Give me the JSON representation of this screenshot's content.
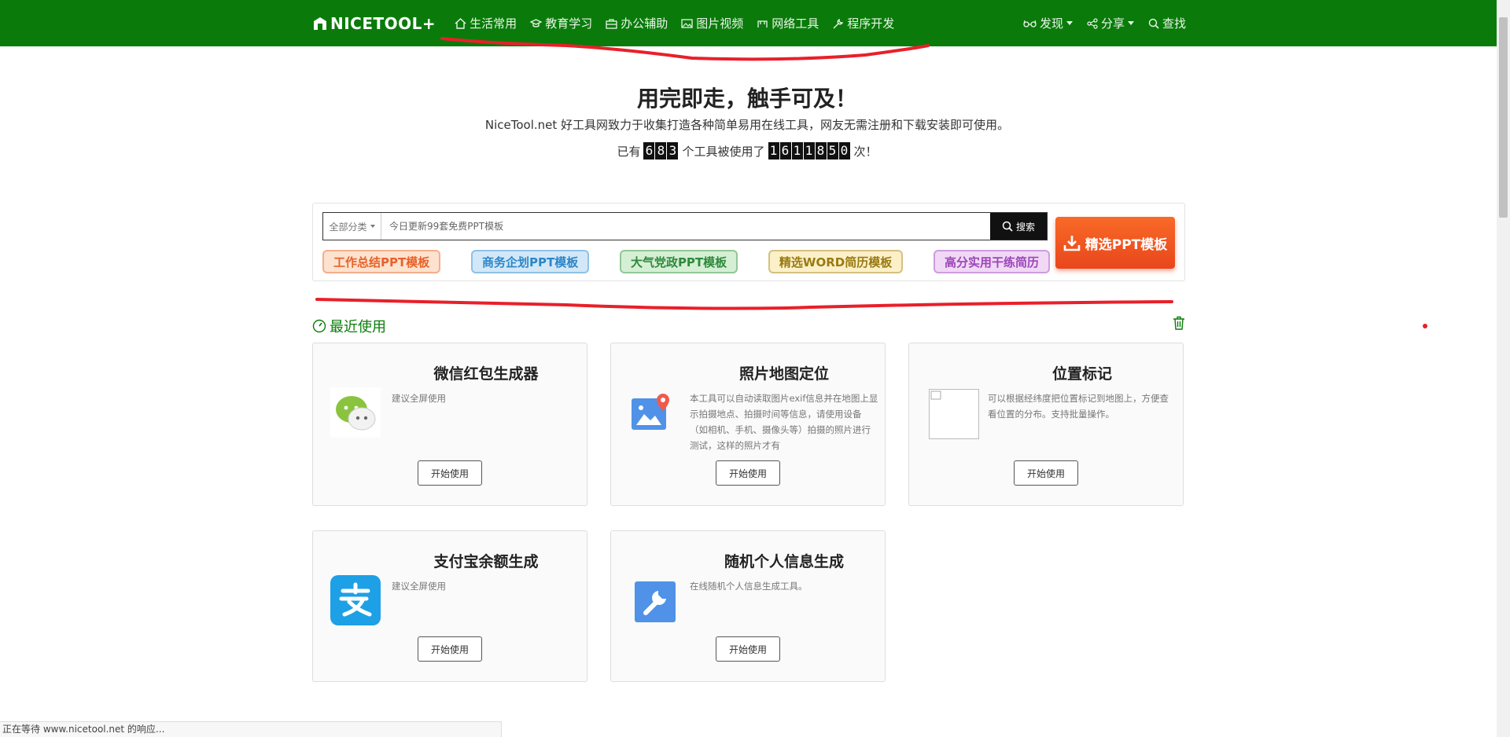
{
  "nav": {
    "logo": "NICETOOL+",
    "items": [
      {
        "label": "生活常用",
        "icon": "home-icon"
      },
      {
        "label": "教育学习",
        "icon": "graduation-cap-icon"
      },
      {
        "label": "办公辅助",
        "icon": "briefcase-icon"
      },
      {
        "label": "图片视频",
        "icon": "image-icon"
      },
      {
        "label": "网络工具",
        "icon": "network-icon"
      },
      {
        "label": "程序开发",
        "icon": "wrench-icon"
      }
    ],
    "right": [
      {
        "label": "发现",
        "icon": "glasses-icon"
      },
      {
        "label": "分享",
        "icon": "share-icon"
      },
      {
        "label": "查找",
        "icon": "search-icon"
      }
    ]
  },
  "hero": {
    "title": "用完即走，触手可及！",
    "subtitle": "NiceTool.net 好工具网致力于收集打造各种简单易用在线工具，网友无需注册和下载安装即可使用。",
    "prefix": "已有",
    "tool_count": "683",
    "middle": "个工具被使用了",
    "use_count": "1611850",
    "suffix": "次！"
  },
  "search": {
    "category": "全部分类",
    "placeholder": "今日更新99套免费PPT模板",
    "button": "搜索",
    "ppt_button": "精选PPT模板"
  },
  "tags": [
    {
      "label": "工作总结PPT模板",
      "color": "#e8622a",
      "bg": "#fde2cf"
    },
    {
      "label": "商务企划PPT模板",
      "color": "#2b86c9",
      "bg": "#d2e8f8"
    },
    {
      "label": "大气党政PPT模板",
      "color": "#2e8a3b",
      "bg": "#d5efd4"
    },
    {
      "label": "精选WORD简历模板",
      "color": "#9a7a12",
      "bg": "#fbf0c8"
    },
    {
      "label": "高分实用干练简历",
      "color": "#9c46b8",
      "bg": "#f0d8f6"
    }
  ],
  "recent": {
    "title": "最近使用",
    "start_label": "开始使用",
    "cards": [
      {
        "title": "微信红包生成器",
        "desc": "建议全屏使用",
        "icon": "wechat-icon"
      },
      {
        "title": "照片地图定位",
        "desc": "本工具可以自动读取图片exif信息并在地图上显示拍摄地点、拍摄时间等信息，请使用设备（如相机、手机、摄像头等）拍摄的照片进行测试，这样的照片才有",
        "icon": "photo-location-icon"
      },
      {
        "title": "位置标记",
        "desc": "可以根据经纬度把位置标记到地图上，方便查看位置的分布。支持批量操作。",
        "icon": "broken-image-icon"
      },
      {
        "title": "支付宝余额生成",
        "desc": "建议全屏使用",
        "icon": "alipay-icon"
      },
      {
        "title": "随机个人信息生成",
        "desc": "在线随机个人信息生成工具。",
        "icon": "wrench-tool-icon"
      }
    ]
  },
  "status": "正在等待 www.nicetool.net 的响应..."
}
